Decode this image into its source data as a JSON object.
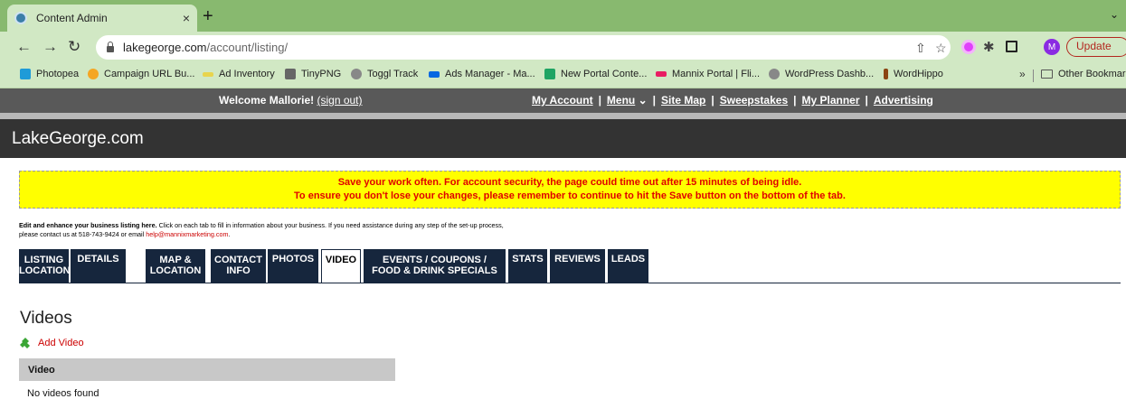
{
  "browser": {
    "tab_title": "Content Admin",
    "tab_close": "×",
    "new_tab": "+",
    "tabs_menu": "⌄",
    "url_domain": "lakegeorge.com",
    "url_path": "/account/listing/",
    "profile_initial": "M",
    "update_label": "Update",
    "bookmarks": [
      {
        "label": "Photopea",
        "color": "#1f9bd8"
      },
      {
        "label": "Campaign URL Bu...",
        "color": "#f5a623"
      },
      {
        "label": "Ad Inventory",
        "color": "#e8d44d"
      },
      {
        "label": "TinyPNG",
        "color": "#666666"
      },
      {
        "label": "Toggl Track",
        "color": "#888888"
      },
      {
        "label": "Ads Manager - Ma...",
        "color": "#0668e1"
      },
      {
        "label": "New Portal Conte...",
        "color": "#1fa463"
      },
      {
        "label": "Mannix Portal | Fli...",
        "color": "#e91e63"
      },
      {
        "label": "WordPress Dashb...",
        "color": "#888888"
      },
      {
        "label": "WordHippo",
        "color": "#8b4513"
      }
    ],
    "bookmarks_more": "»",
    "other_bookmarks": "Other Bookmarks"
  },
  "site": {
    "welcome_text": "Welcome Mallorie!",
    "sign_out": "(sign out)",
    "nav": {
      "my_account": "My Account",
      "menu": "Menu",
      "menu_caret": "⌄",
      "site_map": "Site Map",
      "sweepstakes": "Sweepstakes",
      "my_planner": "My Planner",
      "advertising": "Advertising"
    },
    "nav_sep": "|",
    "logo": "LakeGeorge.com"
  },
  "notice": {
    "line1": "Save your work often. For account security, the page could time out after 15 minutes of being idle.",
    "line2": "To ensure you don't lose your changes, please remember to continue to hit the Save button on the bottom of the tab."
  },
  "intro": {
    "bold": "Edit and enhance your business listing here.",
    "text1": " Click on each tab to fill in information about your business. If you need assistance during any step of the set-up process,",
    "text2": "please contact us at 518-743-9424 or email ",
    "email": "help@mannixmarketing.com",
    "end": "."
  },
  "tabs": [
    {
      "l1": "LISTING",
      "l2": "LOCATIONS"
    },
    {
      "l1": "DETAILS",
      "l2": ""
    },
    {
      "l1": "MAP &",
      "l2": "LOCATION"
    },
    {
      "l1": "CONTACT",
      "l2": "INFO"
    },
    {
      "l1": "PHOTOS",
      "l2": ""
    },
    {
      "l1": "VIDEO",
      "l2": ""
    },
    {
      "l1": "EVENTS / COUPONS /",
      "l2": "FOOD & DRINK SPECIALS"
    },
    {
      "l1": "STATS",
      "l2": ""
    },
    {
      "l1": "REVIEWS",
      "l2": ""
    },
    {
      "l1": "LEADS",
      "l2": ""
    }
  ],
  "content": {
    "title": "Videos",
    "add_video": "Add Video",
    "column_header": "Video",
    "empty_message": "No videos found"
  },
  "colors": {
    "chrome_green": "#88b96f",
    "tab_navy": "#16263d",
    "notice_yellow": "#ffff00",
    "notice_red": "#e00000",
    "link_red": "#cc0000"
  }
}
